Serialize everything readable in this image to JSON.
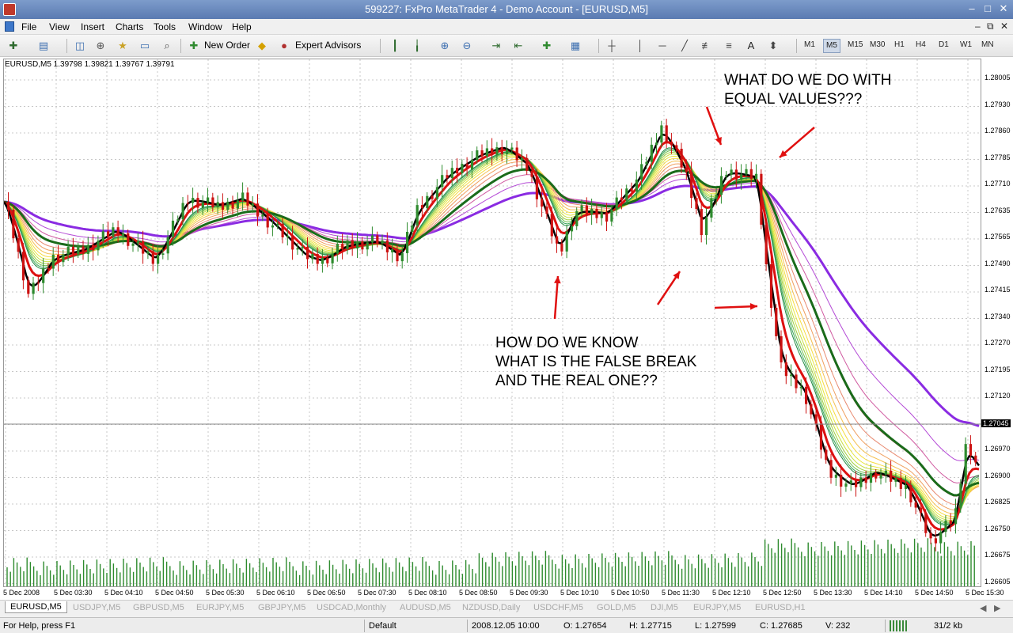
{
  "window": {
    "title": "599227: FxPro MetaTrader 4 - Demo Account - [EURUSD,M5]",
    "minimize": "–",
    "maximize": "□",
    "close": "✕"
  },
  "menu": {
    "items": [
      "File",
      "View",
      "Insert",
      "Charts",
      "Tools",
      "Window",
      "Help"
    ],
    "mdi_controls": [
      "–",
      "⧉",
      "✕"
    ]
  },
  "toolbar": {
    "new_order": "New Order",
    "expert_advisors": "Expert Advisors",
    "timeframes": [
      "M1",
      "M5",
      "M15",
      "M30",
      "H1",
      "H4",
      "D1",
      "W1",
      "MN"
    ],
    "active_timeframe": "M5",
    "text_tool": "A"
  },
  "chart": {
    "symbol_info": "EURUSD,M5  1.39798 1.39821 1.39767 1.39791",
    "price_labels": [
      "1.28005",
      "1.27930",
      "1.27860",
      "1.27785",
      "1.27710",
      "1.27635",
      "1.27565",
      "1.27490",
      "1.27415",
      "1.27340",
      "1.27270",
      "1.27195",
      "1.27120",
      "1.27045",
      "1.26970",
      "1.26900",
      "1.26825",
      "1.26750",
      "1.26675",
      "1.26605"
    ],
    "current_price": "1.27045",
    "time_labels": [
      "5 Dec 2008",
      "5 Dec 03:30",
      "5 Dec 04:10",
      "5 Dec 04:50",
      "5 Dec 05:30",
      "5 Dec 06:10",
      "5 Dec 06:50",
      "5 Dec 07:30",
      "5 Dec 08:10",
      "5 Dec 08:50",
      "5 Dec 09:30",
      "5 Dec 10:10",
      "5 Dec 10:50",
      "5 Dec 11:30",
      "5 Dec 12:10",
      "5 Dec 12:50",
      "5 Dec 13:30",
      "5 Dec 14:10",
      "5 Dec 14:50",
      "5 Dec 15:30"
    ],
    "annotation_top": "WHAT DO WE DO WITH\nEQUAL VALUES???",
    "annotation_bottom": "HOW DO WE KNOW\nWHAT IS THE FALSE BREAK\nAND THE REAL ONE??",
    "colors": {
      "bull": "#2e8b2e",
      "bear": "#cc1111",
      "volume": "#2e8b2e",
      "grid": "#c8c8c8"
    }
  },
  "tabs": {
    "items": [
      "EURUSD,M5",
      "USDJPY,M5",
      "GBPUSD,M5",
      "EURJPY,M5",
      "GBPJPY,M5",
      "USDCAD,Monthly",
      "AUDUSD,M5",
      "NZDUSD,Daily",
      "USDCHF,M5",
      "GOLD,M5",
      "DJI,M5",
      "EURJPY,M5",
      "EURUSD,H1"
    ],
    "active": 0
  },
  "status": {
    "help": "For Help, press F1",
    "profile": "Default",
    "datetime": "2008.12.05 10:00",
    "open": "O: 1.27654",
    "high": "H: 1.27715",
    "low": "L: 1.27599",
    "close": "C: 1.27685",
    "volume": "V: 232",
    "traffic": "31/2 kb"
  }
}
